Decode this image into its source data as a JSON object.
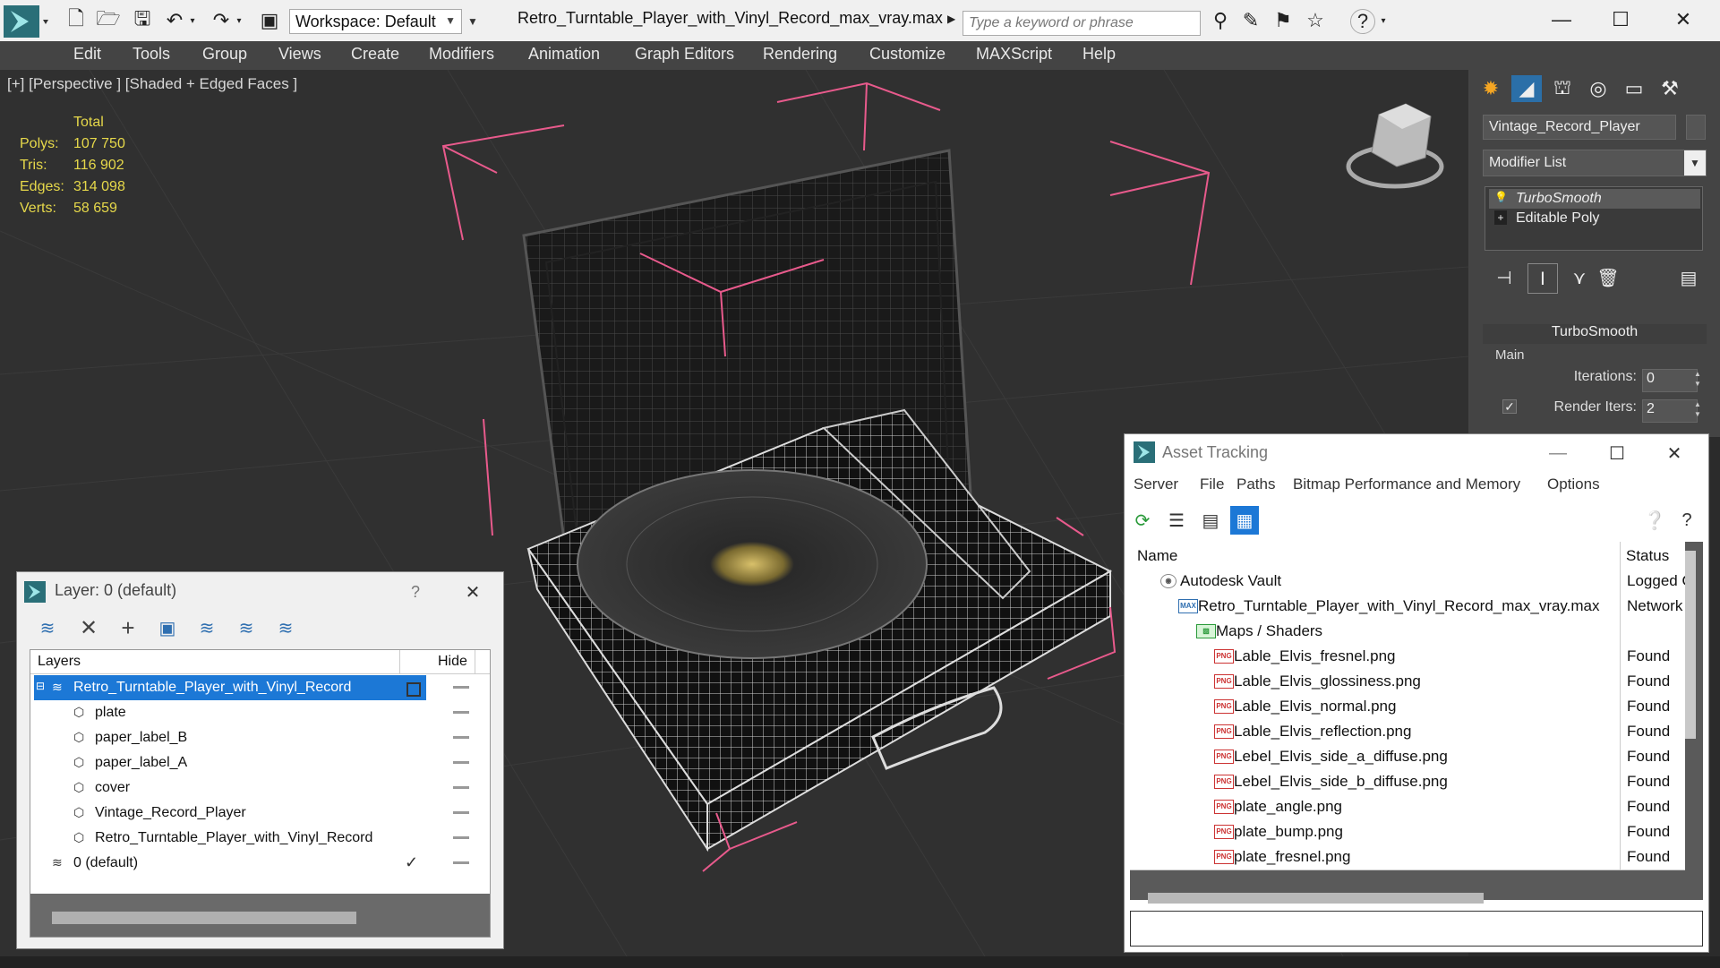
{
  "titlebar": {
    "workspace": "Workspace: Default",
    "document_title": "Retro_Turntable_Player_with_Vinyl_Record_max_vray.max",
    "search_placeholder": "Type a keyword or phrase"
  },
  "menu": [
    "Edit",
    "Tools",
    "Group",
    "Views",
    "Create",
    "Modifiers",
    "Animation",
    "Graph Editors",
    "Rendering",
    "Customize",
    "MAXScript",
    "Help"
  ],
  "viewport": {
    "label": "[+] [Perspective ] [Shaded + Edged Faces ]",
    "stats": {
      "header": "Total",
      "rows": [
        {
          "label": "Polys:",
          "value": "107 750"
        },
        {
          "label": "Tris:",
          "value": "116 902"
        },
        {
          "label": "Edges:",
          "value": "314 098"
        },
        {
          "label": "Verts:",
          "value": "58 659"
        }
      ]
    },
    "stats_color": "#e6d84a",
    "bbox_color": "#e85a8c"
  },
  "command_panel": {
    "object_name": "Vintage_Record_Player",
    "modifier_list": "Modifier List",
    "stack": [
      "TurboSmooth",
      "Editable Poly"
    ],
    "rollout_title": "TurboSmooth",
    "group_main": "Main",
    "iterations_label": "Iterations:",
    "iterations_value": "0",
    "render_iters_label": "Render Iters:",
    "render_iters_value": "2"
  },
  "layer_window": {
    "title": "Layer: 0 (default)",
    "help": "?",
    "columns": {
      "layers": "Layers",
      "hide": "Hide"
    },
    "rows": [
      {
        "name": "Retro_Turntable_Player_with_Vinyl_Record",
        "type": "layer",
        "selected": true
      },
      {
        "name": "plate",
        "type": "object"
      },
      {
        "name": "paper_label_B",
        "type": "object"
      },
      {
        "name": "paper_label_A",
        "type": "object"
      },
      {
        "name": "cover",
        "type": "object"
      },
      {
        "name": "Vintage_Record_Player",
        "type": "object"
      },
      {
        "name": "Retro_Turntable_Player_with_Vinyl_Record",
        "type": "object"
      },
      {
        "name": "0 (default)",
        "type": "layer",
        "active": true
      }
    ]
  },
  "asset_tracking": {
    "title": "Asset Tracking",
    "menu": [
      "Server",
      "File",
      "Paths",
      "Bitmap Performance and Memory",
      "Options"
    ],
    "columns": {
      "name": "Name",
      "status": "Status"
    },
    "rows": [
      {
        "name": "Autodesk Vault",
        "status": "Logged O",
        "level": 1,
        "kind": "vault"
      },
      {
        "name": "Retro_Turntable_Player_with_Vinyl_Record_max_vray.max",
        "status": "Network",
        "level": 2,
        "kind": "max"
      },
      {
        "name": "Maps / Shaders",
        "status": "",
        "level": 3,
        "kind": "maps"
      },
      {
        "name": "Lable_Elvis_fresnel.png",
        "status": "Found",
        "level": 4,
        "kind": "png"
      },
      {
        "name": "Lable_Elvis_glossiness.png",
        "status": "Found",
        "level": 4,
        "kind": "png"
      },
      {
        "name": "Lable_Elvis_normal.png",
        "status": "Found",
        "level": 4,
        "kind": "png"
      },
      {
        "name": "Lable_Elvis_reflection.png",
        "status": "Found",
        "level": 4,
        "kind": "png"
      },
      {
        "name": "Lebel_Elvis_side_a_diffuse.png",
        "status": "Found",
        "level": 4,
        "kind": "png"
      },
      {
        "name": "Lebel_Elvis_side_b_diffuse.png",
        "status": "Found",
        "level": 4,
        "kind": "png"
      },
      {
        "name": "plate_angle.png",
        "status": "Found",
        "level": 4,
        "kind": "png"
      },
      {
        "name": "plate_bump.png",
        "status": "Found",
        "level": 4,
        "kind": "png"
      },
      {
        "name": "plate_fresnel.png",
        "status": "Found",
        "level": 4,
        "kind": "png"
      }
    ],
    "png_tag": "PNG"
  }
}
